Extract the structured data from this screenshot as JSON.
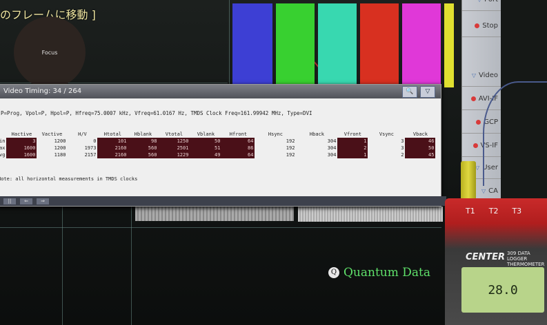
{
  "screen": {
    "caption": "のフレームに移動 ]",
    "focus_label": "Focus",
    "color_bars": [
      "#3d3fd4",
      "#38d030",
      "#38d8b0",
      "#d83020",
      "#e038d8",
      "#e0e030"
    ]
  },
  "dialog": {
    "title": "Video Timing: 34 / 264",
    "zoom_btn": "🔍",
    "menu_btn": "▽",
    "info": "P=Prog, Vpol=P, Hpol=P, Hfreq=75.0007 kHz, Vfreq=61.0167 Hz, TMDS Clock Freq=161.99942 MHz, Type=DVI",
    "columns": [
      "Hactive",
      "Vactive",
      "H/V",
      "Htotal",
      "Hblank",
      "Vtotal",
      "Vblank",
      "Hfront",
      "Hsync",
      "Hback",
      "Vfront",
      "Vsync",
      "Vback"
    ],
    "rows": [
      {
        "label": "in",
        "cells": [
          "3",
          "1200",
          "0",
          "101",
          "98",
          "1250",
          "50",
          "64",
          "192",
          "304",
          "1",
          "3",
          "46"
        ]
      },
      {
        "label": "ax",
        "cells": [
          "1600",
          "1200",
          "1973",
          "2160",
          "560",
          "2501",
          "51",
          "86",
          "192",
          "304",
          "2",
          "3",
          "50"
        ]
      },
      {
        "label": "vg",
        "cells": [
          "1600",
          "1180",
          "2157",
          "2160",
          "560",
          "1229",
          "49",
          "64",
          "192",
          "304",
          "1",
          "2",
          "45"
        ]
      }
    ],
    "note": "Note: all horizontal measurements in TMDS clocks",
    "toolbar": [
      "||",
      "⇐",
      "⇒"
    ]
  },
  "brand": {
    "logo": "Q",
    "name": "Quantum Data"
  },
  "side_panel": {
    "items": [
      {
        "label": "Port",
        "mark": "tri"
      },
      {
        "label": "Stop",
        "mark": "dot"
      },
      {
        "label": "Video",
        "mark": "tri"
      },
      {
        "label": "AVI-IF",
        "mark": "dot"
      },
      {
        "label": "GCP",
        "mark": "dot"
      },
      {
        "label": "VS-IF",
        "mark": "dot"
      },
      {
        "label": "User",
        "mark": "tri"
      },
      {
        "label": "CA",
        "mark": "tri"
      }
    ]
  },
  "meter": {
    "tabs": [
      "T1",
      "T2",
      "T3"
    ],
    "brand": "CENTER",
    "model": "309 DATA LOGGER THERMOMETER",
    "reading": "28.0"
  }
}
